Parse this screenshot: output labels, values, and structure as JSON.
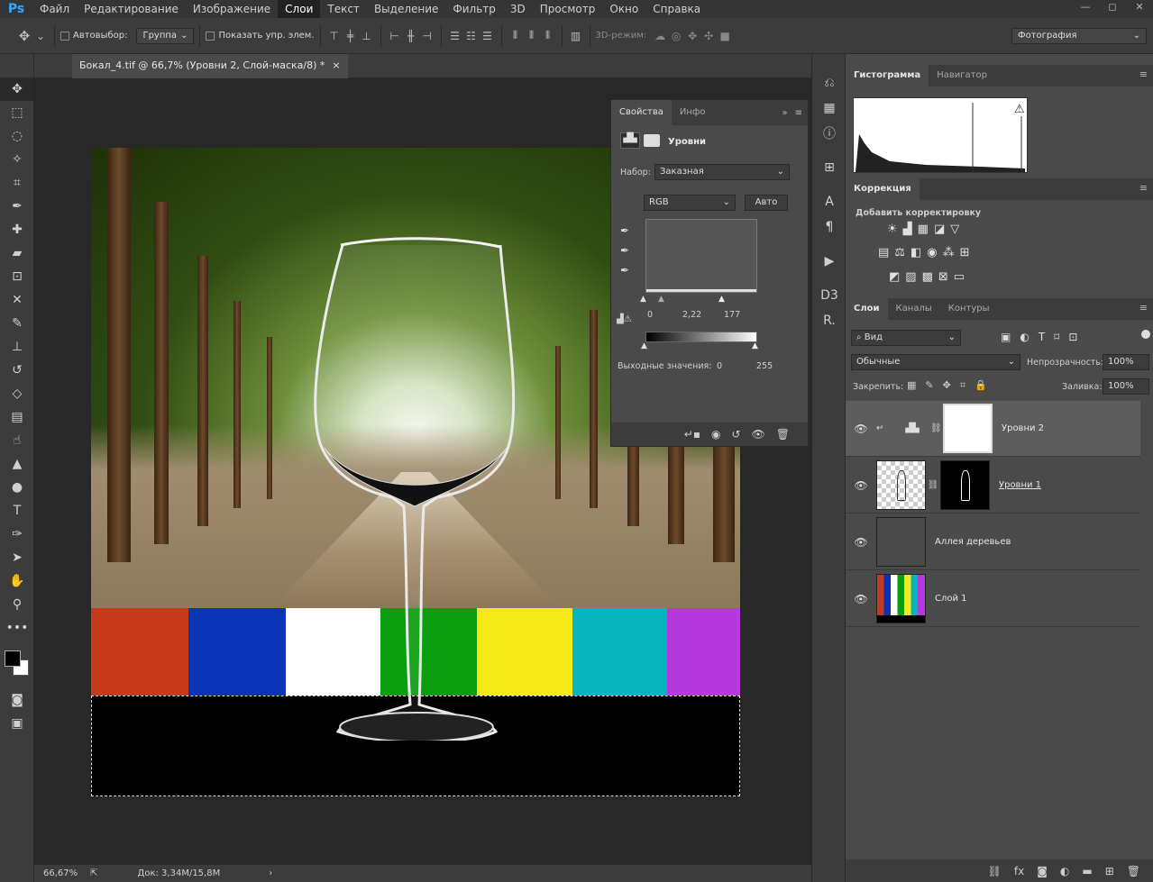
{
  "app": {
    "logo": "Ps"
  },
  "menu": [
    "Файл",
    "Редактирование",
    "Изображение",
    "Слои",
    "Текст",
    "Выделение",
    "Фильтр",
    "3D",
    "Просмотр",
    "Окно",
    "Справка"
  ],
  "menu_active": "Слои",
  "window_controls": [
    "—",
    "◻",
    "✕"
  ],
  "options": {
    "autoselect_label": "Автовыбор:",
    "autoselect_value": "Группа",
    "show_controls_label": "Показать упр. элем.",
    "mode3d_label": "3D-режим:",
    "workspace": "Фотография"
  },
  "document": {
    "tab_title": "Бокал_4.tif @ 66,7% (Уровни 2, Слой-маска/8) *",
    "zoom": "66,67%",
    "doc_size": "Док: 3,34M/15,8M"
  },
  "properties": {
    "tabs": [
      "Свойства",
      "Инфо"
    ],
    "header": "Уровни",
    "preset_label": "Набор:",
    "preset_value": "Заказная",
    "channel": "RGB",
    "auto_button": "Авто",
    "input_black": "0",
    "input_gamma": "2,22",
    "input_white": "177",
    "output_label": "Выходные значения:",
    "output_black": "0",
    "output_white": "255"
  },
  "histogram_panel": {
    "tabs": [
      "Гистограмма",
      "Навигатор"
    ]
  },
  "correction_panel": {
    "tab": "Коррекция",
    "subtitle": "Добавить корректировку"
  },
  "layers_panel": {
    "tabs": [
      "Слои",
      "Каналы",
      "Контуры"
    ],
    "filter": "Вид",
    "blend_mode": "Обычные",
    "opacity_label": "Непрозрачность:",
    "opacity_value": "100%",
    "lock_label": "Закрепить:",
    "fill_label": "Заливка:",
    "fill_value": "100%",
    "layers": [
      {
        "name": "Уровни 2"
      },
      {
        "name": "Уровни 1"
      },
      {
        "name": "Аллея деревьев"
      },
      {
        "name": "Слой 1"
      }
    ],
    "footer_icons": [
      "link-icon",
      "fx-icon",
      "mask-icon",
      "adjustment-icon",
      "folder-icon",
      "new-layer-icon",
      "trash-icon"
    ]
  },
  "colors": {
    "bars": [
      "#c8391c",
      "#0b33b8",
      "#ffffff",
      "#0a9e10",
      "#f5ea18",
      "#05b6bf",
      "#b43ae0"
    ]
  }
}
